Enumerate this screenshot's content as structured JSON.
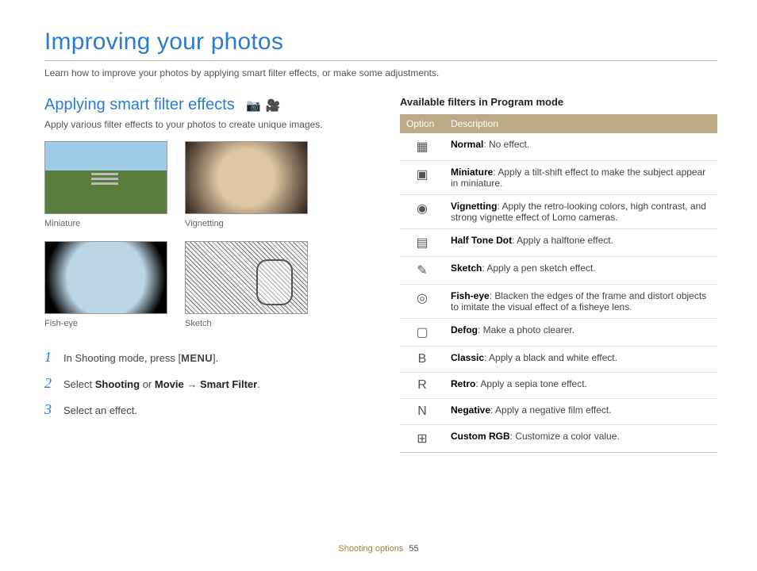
{
  "page_title": "Improving your photos",
  "page_subtitle": "Learn how to improve your photos by applying smart filter effects, or make some adjustments.",
  "section_title": "Applying smart filter effects",
  "section_intro": "Apply various filter effects to your photos to create unique images.",
  "thumbs": {
    "a_cap": "Miniature",
    "b_cap": "Vignetting",
    "c_cap": "Fish-eye",
    "d_cap": "Sketch"
  },
  "steps": {
    "s1_pre": "In Shooting mode, press [",
    "s1_menu": "MENU",
    "s1_post": "].",
    "s2_pre": "Select ",
    "s2_b1": "Shooting",
    "s2_or": " or ",
    "s2_b2": "Movie",
    "s2_arrow": " → ",
    "s2_b3": "Smart Filter",
    "s2_post": ".",
    "s3": "Select an effect."
  },
  "table_heading": "Available filters in Program mode",
  "th_option": "Option",
  "th_desc": "Description",
  "rows": [
    {
      "name": "Normal",
      "desc": ": No effect."
    },
    {
      "name": "Miniature",
      "desc": ": Apply a tilt-shift effect to make the subject appear in miniature."
    },
    {
      "name": "Vignetting",
      "desc": ": Apply the retro-looking colors, high contrast, and strong vignette effect of Lomo cameras."
    },
    {
      "name": "Half Tone Dot",
      "desc": ": Apply a halftone effect."
    },
    {
      "name": "Sketch",
      "desc": ": Apply a pen sketch effect."
    },
    {
      "name": "Fish-eye",
      "desc": ": Blacken the edges of the frame and distort objects to imitate the visual effect of a fisheye lens."
    },
    {
      "name": "Defog",
      "desc": ": Make a photo clearer."
    },
    {
      "name": "Classic",
      "desc": ": Apply a black and white effect."
    },
    {
      "name": "Retro",
      "desc": ": Apply a sepia tone effect."
    },
    {
      "name": "Negative",
      "desc": ": Apply a negative film effect."
    },
    {
      "name": "Custom RGB",
      "desc": ": Customize a color value."
    }
  ],
  "icons": [
    "▦",
    "▣",
    "◉",
    "▤",
    "✎",
    "◎",
    "▢",
    "B",
    "R",
    "N",
    "⊞"
  ],
  "footer_section": "Shooting options",
  "footer_page": "55"
}
